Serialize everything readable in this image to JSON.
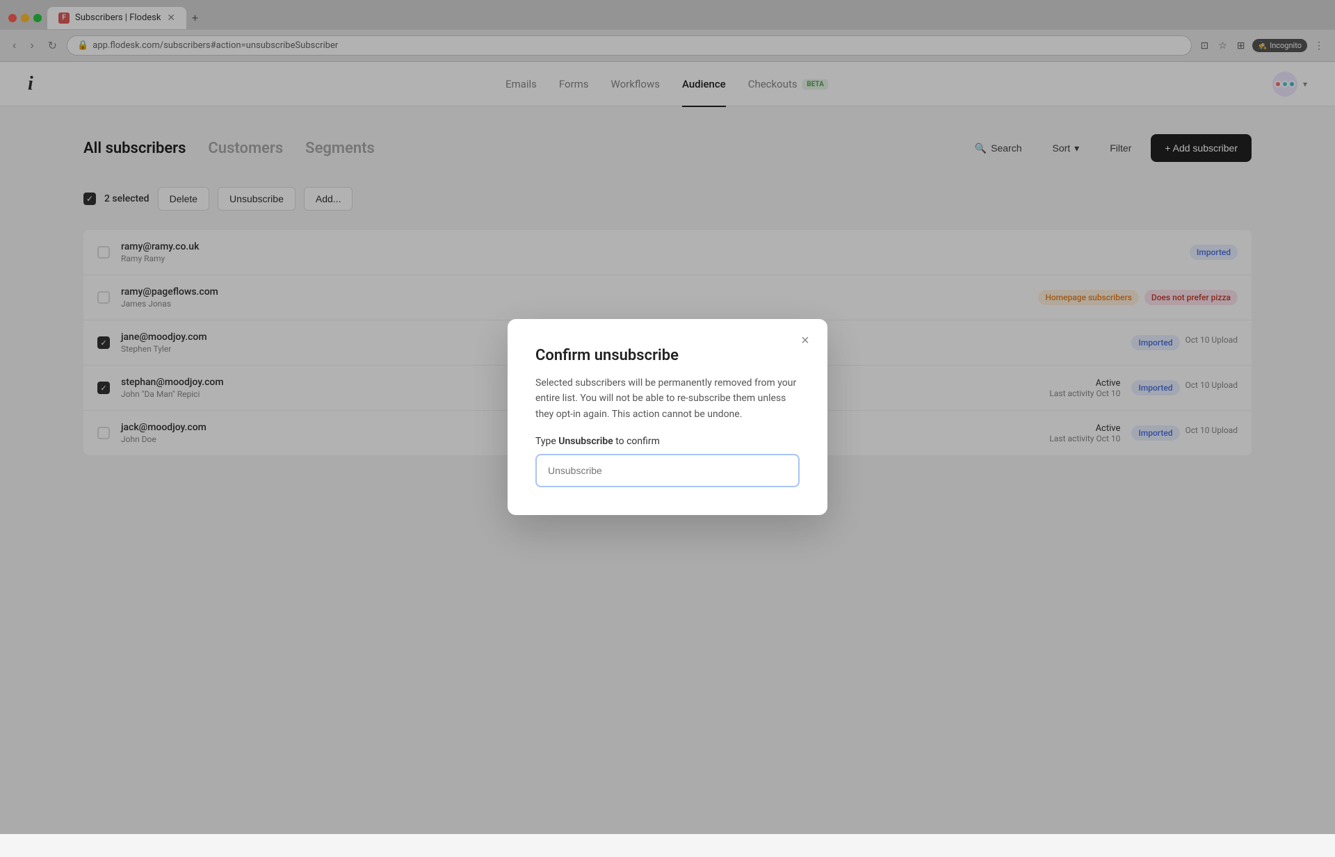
{
  "browser": {
    "tab_title": "Subscribers | Flodesk",
    "tab_favicon": "F",
    "url": "app.flodesk.com/subscribers#action=unsubscribeSubscriber",
    "incognito_label": "Incognito"
  },
  "nav": {
    "logo": "i",
    "items": [
      {
        "label": "Emails",
        "active": false
      },
      {
        "label": "Forms",
        "active": false
      },
      {
        "label": "Workflows",
        "active": false
      },
      {
        "label": "Audience",
        "active": true
      },
      {
        "label": "Checkouts",
        "active": false,
        "badge": "BETA"
      }
    ]
  },
  "page": {
    "tabs": [
      {
        "label": "All subscribers",
        "active": true
      },
      {
        "label": "Customers",
        "active": false
      },
      {
        "label": "Segments",
        "active": false
      }
    ],
    "search_label": "Search",
    "sort_label": "Sort",
    "filter_label": "Filter",
    "add_button": "+ Add subscriber"
  },
  "toolbar": {
    "selected_count": "2 selected",
    "delete_label": "Delete",
    "unsubscribe_label": "Unsubscribe",
    "add_label": "Add..."
  },
  "subscribers": [
    {
      "email": "ramy@ramy.co.uk",
      "name": "Ramy Ramy",
      "checked": false,
      "status": "",
      "status_detail": "",
      "tags": [
        {
          "label": "Imported",
          "type": "imported"
        }
      ],
      "upload": ""
    },
    {
      "email": "ramy@pageflows.com",
      "name": "James Jonas",
      "checked": false,
      "status": "",
      "status_detail": "",
      "tags": [
        {
          "label": "Homepage subscribers",
          "type": "orange"
        },
        {
          "label": "Does not prefer pizza",
          "type": "pink"
        }
      ],
      "upload": ""
    },
    {
      "email": "jane@moodjoy.com",
      "name": "Stephen Tyler",
      "checked": true,
      "status": "",
      "status_detail": "",
      "tags": [
        {
          "label": "Imported",
          "type": "imported"
        }
      ],
      "upload": "Oct 10 Upload"
    },
    {
      "email": "stephan@moodjoy.com",
      "name": "John \"Da Man\" Repici",
      "checked": true,
      "status": "Active",
      "status_detail": "Last activity Oct 10",
      "tags": [
        {
          "label": "Imported",
          "type": "imported"
        }
      ],
      "upload": "Oct 10 Upload"
    },
    {
      "email": "jack@moodjoy.com",
      "name": "John Doe",
      "checked": false,
      "status": "Active",
      "status_detail": "Last activity Oct 10",
      "tags": [
        {
          "label": "Imported",
          "type": "imported"
        }
      ],
      "upload": "Oct 10 Upload"
    }
  ],
  "modal": {
    "title": "Confirm unsubscribe",
    "body": "Selected subscribers will be permanently removed from your entire list. You will not be able to re-subscribe them unless they opt-in again. This action cannot be undone.",
    "confirm_prefix": "Type ",
    "confirm_keyword": "Unsubscribe",
    "confirm_suffix": " to confirm",
    "input_placeholder": "Unsubscribe",
    "close_icon": "×"
  }
}
